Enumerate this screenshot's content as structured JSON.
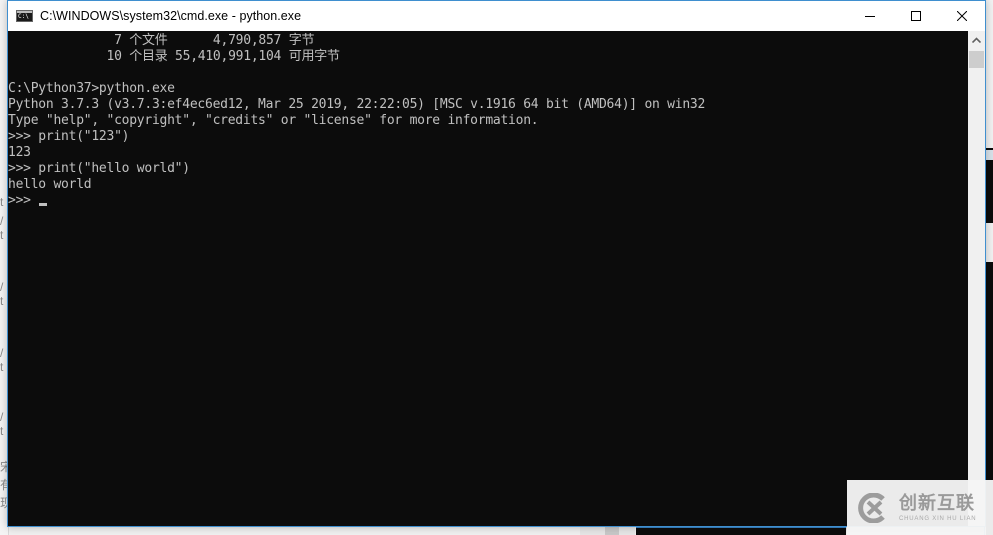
{
  "window": {
    "title": "C:\\WINDOWS\\system32\\cmd.exe - python.exe",
    "icon": "cmd-icon",
    "icon_glyph": "C:\\",
    "buttons": {
      "minimize": "minimize-icon",
      "maximize": "maximize-icon",
      "close": "close-icon"
    }
  },
  "console": {
    "text_color": "#c0c0c0",
    "background": "#0c0c0c",
    "lines": [
      "              7 个文件      4,790,857 字节",
      "             10 个目录 55,410,991,104 可用字节",
      "",
      "C:\\Python37>python.exe",
      "Python 3.7.3 (v3.7.3:ef4ec6ed12, Mar 25 2019, 22:22:05) [MSC v.1916 64 bit (AMD64)] on win32",
      "Type \"help\", \"copyright\", \"credits\" or \"license\" for more information.",
      ">>> print(\"123\")",
      "123",
      ">>> print(\"hello world\")",
      "hello world"
    ],
    "prompt": ">>> "
  },
  "scrollbar": {
    "up_icon": "chevron-up-icon",
    "position": 0
  },
  "watermark": {
    "name_cn": "创新互联",
    "name_en": "CHUANG XIN HU LIAN"
  },
  "background_fragments": {
    "left": [
      "t",
      "/",
      "t",
      "/",
      "t",
      "/",
      "t",
      "/",
      "t",
      "宋",
      "有",
      "现"
    ]
  }
}
